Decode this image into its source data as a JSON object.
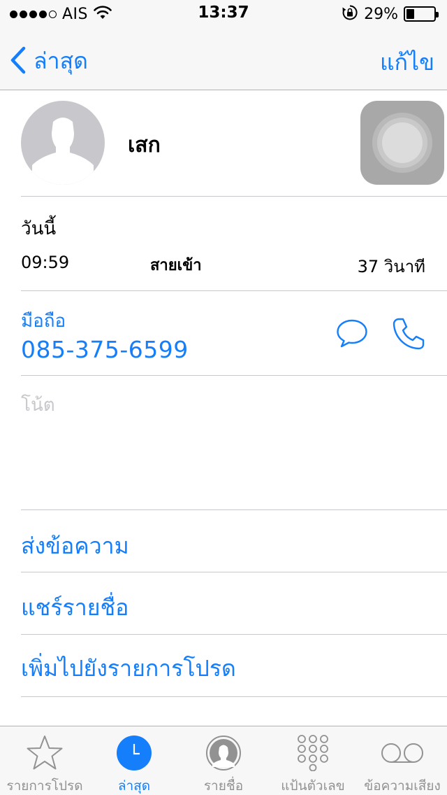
{
  "status_bar": {
    "carrier": "AIS",
    "time": "13:37",
    "battery_percent": "29%",
    "battery_level": 0.29,
    "signal_bars_filled": 4,
    "signal_bars_total": 5
  },
  "nav": {
    "back_label": "ล่าสุด",
    "edit_label": "แก้ไข"
  },
  "contact": {
    "name": "เสก"
  },
  "recent_call": {
    "day": "วันนี้",
    "time": "09:59",
    "type": "สายเข้า",
    "duration": "37 วินาที"
  },
  "phone": {
    "label": "มือถือ",
    "number": "085-375-6599"
  },
  "notes": {
    "placeholder": "โน้ต"
  },
  "actions": {
    "send_message": "ส่งข้อความ",
    "share_contact": "แชร์รายชื่อ",
    "add_to_favorites": "เพิ่มไปยังรายการโปรด"
  },
  "tabs": [
    {
      "label": "รายการโปรด",
      "icon": "star-icon",
      "active": false
    },
    {
      "label": "ล่าสุด",
      "icon": "clock-icon",
      "active": true
    },
    {
      "label": "รายชื่อ",
      "icon": "contacts-icon",
      "active": false
    },
    {
      "label": "แป้นตัวเลข",
      "icon": "keypad-icon",
      "active": false
    },
    {
      "label": "ข้อความเสียง",
      "icon": "voicemail-icon",
      "active": false
    }
  ],
  "colors": {
    "accent": "#147efb",
    "inactive_tab": "#929292",
    "separator": "#c8c7cc",
    "placeholder": "#c7c7cc",
    "bar_background": "#f7f7f7"
  }
}
